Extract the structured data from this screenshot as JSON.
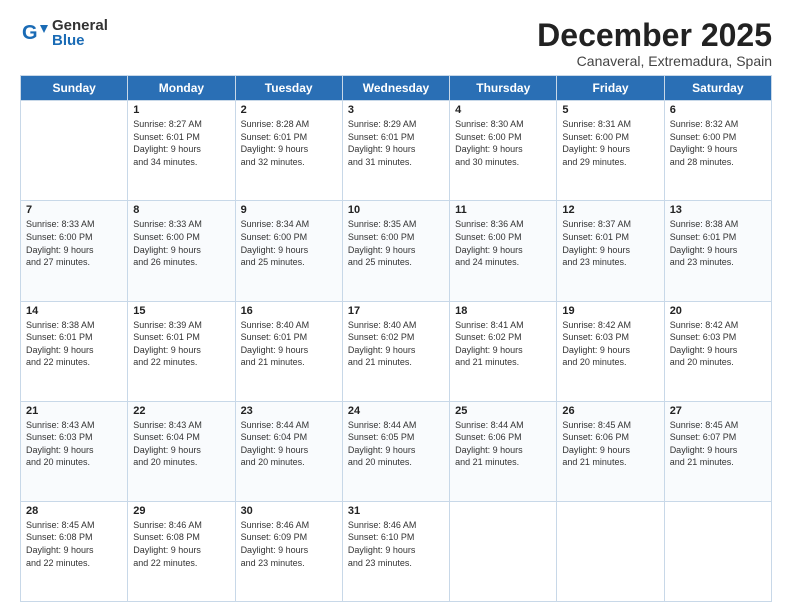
{
  "logo": {
    "general": "General",
    "blue": "Blue"
  },
  "title": "December 2025",
  "subtitle": "Canaveral, Extremadura, Spain",
  "days": [
    "Sunday",
    "Monday",
    "Tuesday",
    "Wednesday",
    "Thursday",
    "Friday",
    "Saturday"
  ],
  "weeks": [
    [
      {
        "date": "",
        "text": ""
      },
      {
        "date": "1",
        "text": "Sunrise: 8:27 AM\nSunset: 6:01 PM\nDaylight: 9 hours\nand 34 minutes."
      },
      {
        "date": "2",
        "text": "Sunrise: 8:28 AM\nSunset: 6:01 PM\nDaylight: 9 hours\nand 32 minutes."
      },
      {
        "date": "3",
        "text": "Sunrise: 8:29 AM\nSunset: 6:01 PM\nDaylight: 9 hours\nand 31 minutes."
      },
      {
        "date": "4",
        "text": "Sunrise: 8:30 AM\nSunset: 6:00 PM\nDaylight: 9 hours\nand 30 minutes."
      },
      {
        "date": "5",
        "text": "Sunrise: 8:31 AM\nSunset: 6:00 PM\nDaylight: 9 hours\nand 29 minutes."
      },
      {
        "date": "6",
        "text": "Sunrise: 8:32 AM\nSunset: 6:00 PM\nDaylight: 9 hours\nand 28 minutes."
      }
    ],
    [
      {
        "date": "7",
        "text": "Sunrise: 8:33 AM\nSunset: 6:00 PM\nDaylight: 9 hours\nand 27 minutes."
      },
      {
        "date": "8",
        "text": "Sunrise: 8:33 AM\nSunset: 6:00 PM\nDaylight: 9 hours\nand 26 minutes."
      },
      {
        "date": "9",
        "text": "Sunrise: 8:34 AM\nSunset: 6:00 PM\nDaylight: 9 hours\nand 25 minutes."
      },
      {
        "date": "10",
        "text": "Sunrise: 8:35 AM\nSunset: 6:00 PM\nDaylight: 9 hours\nand 25 minutes."
      },
      {
        "date": "11",
        "text": "Sunrise: 8:36 AM\nSunset: 6:00 PM\nDaylight: 9 hours\nand 24 minutes."
      },
      {
        "date": "12",
        "text": "Sunrise: 8:37 AM\nSunset: 6:01 PM\nDaylight: 9 hours\nand 23 minutes."
      },
      {
        "date": "13",
        "text": "Sunrise: 8:38 AM\nSunset: 6:01 PM\nDaylight: 9 hours\nand 23 minutes."
      }
    ],
    [
      {
        "date": "14",
        "text": "Sunrise: 8:38 AM\nSunset: 6:01 PM\nDaylight: 9 hours\nand 22 minutes."
      },
      {
        "date": "15",
        "text": "Sunrise: 8:39 AM\nSunset: 6:01 PM\nDaylight: 9 hours\nand 22 minutes."
      },
      {
        "date": "16",
        "text": "Sunrise: 8:40 AM\nSunset: 6:01 PM\nDaylight: 9 hours\nand 21 minutes."
      },
      {
        "date": "17",
        "text": "Sunrise: 8:40 AM\nSunset: 6:02 PM\nDaylight: 9 hours\nand 21 minutes."
      },
      {
        "date": "18",
        "text": "Sunrise: 8:41 AM\nSunset: 6:02 PM\nDaylight: 9 hours\nand 21 minutes."
      },
      {
        "date": "19",
        "text": "Sunrise: 8:42 AM\nSunset: 6:03 PM\nDaylight: 9 hours\nand 20 minutes."
      },
      {
        "date": "20",
        "text": "Sunrise: 8:42 AM\nSunset: 6:03 PM\nDaylight: 9 hours\nand 20 minutes."
      }
    ],
    [
      {
        "date": "21",
        "text": "Sunrise: 8:43 AM\nSunset: 6:03 PM\nDaylight: 9 hours\nand 20 minutes."
      },
      {
        "date": "22",
        "text": "Sunrise: 8:43 AM\nSunset: 6:04 PM\nDaylight: 9 hours\nand 20 minutes."
      },
      {
        "date": "23",
        "text": "Sunrise: 8:44 AM\nSunset: 6:04 PM\nDaylight: 9 hours\nand 20 minutes."
      },
      {
        "date": "24",
        "text": "Sunrise: 8:44 AM\nSunset: 6:05 PM\nDaylight: 9 hours\nand 20 minutes."
      },
      {
        "date": "25",
        "text": "Sunrise: 8:44 AM\nSunset: 6:06 PM\nDaylight: 9 hours\nand 21 minutes."
      },
      {
        "date": "26",
        "text": "Sunrise: 8:45 AM\nSunset: 6:06 PM\nDaylight: 9 hours\nand 21 minutes."
      },
      {
        "date": "27",
        "text": "Sunrise: 8:45 AM\nSunset: 6:07 PM\nDaylight: 9 hours\nand 21 minutes."
      }
    ],
    [
      {
        "date": "28",
        "text": "Sunrise: 8:45 AM\nSunset: 6:08 PM\nDaylight: 9 hours\nand 22 minutes."
      },
      {
        "date": "29",
        "text": "Sunrise: 8:46 AM\nSunset: 6:08 PM\nDaylight: 9 hours\nand 22 minutes."
      },
      {
        "date": "30",
        "text": "Sunrise: 8:46 AM\nSunset: 6:09 PM\nDaylight: 9 hours\nand 23 minutes."
      },
      {
        "date": "31",
        "text": "Sunrise: 8:46 AM\nSunset: 6:10 PM\nDaylight: 9 hours\nand 23 minutes."
      },
      {
        "date": "",
        "text": ""
      },
      {
        "date": "",
        "text": ""
      },
      {
        "date": "",
        "text": ""
      }
    ]
  ]
}
